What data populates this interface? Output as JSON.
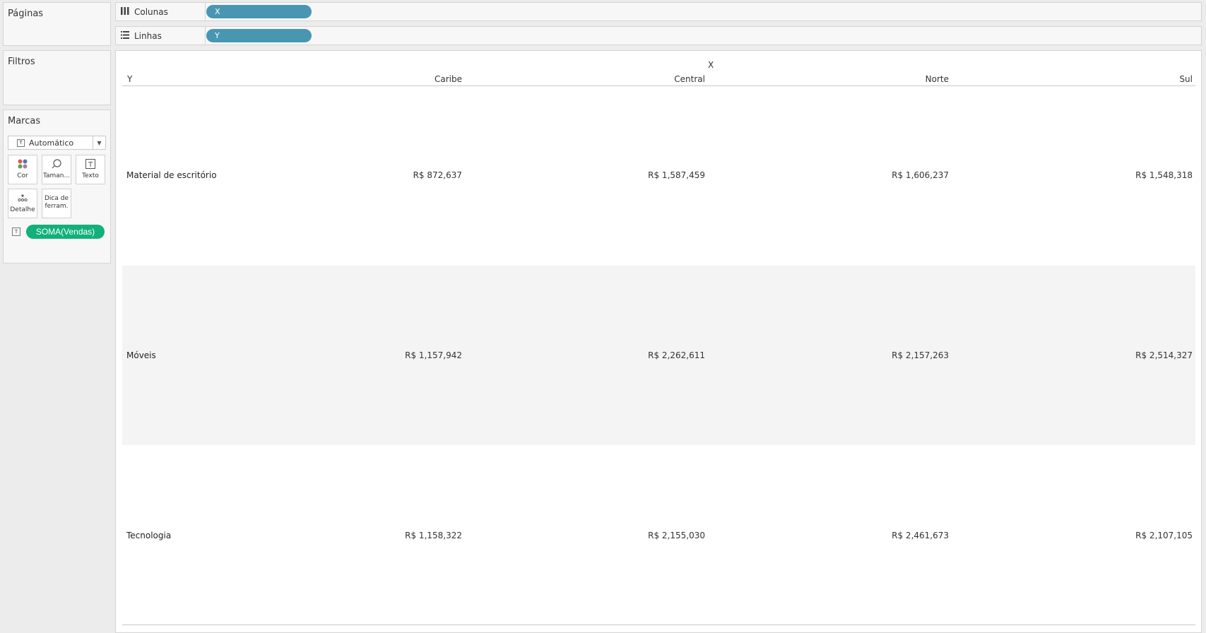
{
  "left_panel": {
    "pages_title": "Páginas",
    "filters_title": "Filtros",
    "marks": {
      "title": "Marcas",
      "type_dropdown": "Automático",
      "buttons": [
        {
          "label": "Cor",
          "icon": "color-dots-icon"
        },
        {
          "label": "Taman...",
          "icon": "size-icon"
        },
        {
          "label": "Texto",
          "icon": "text-icon"
        },
        {
          "label": "Detalhe",
          "icon": "detail-icon"
        },
        {
          "label": "Dica de ferram.",
          "icon": "tooltip-icon"
        }
      ],
      "field_pill": "SOMA(Vendas)"
    }
  },
  "shelves": {
    "columns": {
      "label": "Colunas",
      "pill": "X"
    },
    "rows": {
      "label": "Linhas",
      "pill": "Y"
    }
  },
  "colors": {
    "dimension_pill": "#4996b2",
    "measure_pill": "#12b07b",
    "band": "#f4f4f4"
  },
  "chart_data": {
    "type": "table",
    "column_field": "X",
    "row_field": "Y",
    "columns": [
      "Caribe",
      "Central",
      "Norte",
      "Sul"
    ],
    "rows": [
      {
        "label": "Material de escritório",
        "values": [
          "R$ 872,637",
          "R$ 1,587,459",
          "R$ 1,606,237",
          "R$ 1,548,318"
        ]
      },
      {
        "label": "Móveis",
        "values": [
          "R$ 1,157,942",
          "R$ 2,262,611",
          "R$ 2,157,263",
          "R$ 2,514,327"
        ]
      },
      {
        "label": "Tecnologia",
        "values": [
          "R$ 1,158,322",
          "R$ 2,155,030",
          "R$ 2,461,673",
          "R$ 2,107,105"
        ]
      }
    ]
  }
}
